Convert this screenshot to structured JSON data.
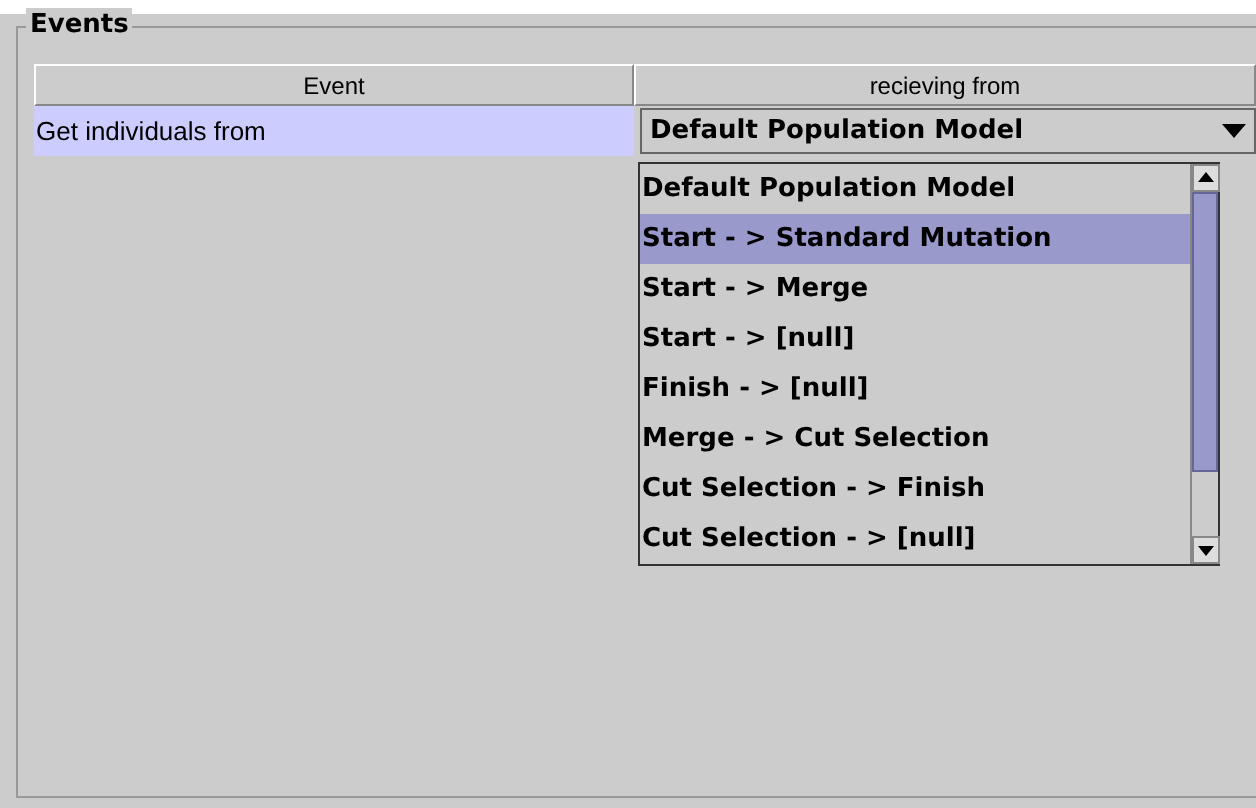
{
  "group": {
    "title": "Events"
  },
  "table": {
    "columns": [
      "Event",
      "recieving from"
    ],
    "rows": [
      {
        "event": "Get individuals from",
        "source": "Default Population Model",
        "selected": true
      }
    ]
  },
  "dropdown": {
    "expanded": true,
    "items": [
      {
        "label": "Default Population Model",
        "selected": false
      },
      {
        "label": "Start - > Standard Mutation",
        "selected": true
      },
      {
        "label": "Start - > Merge",
        "selected": false
      },
      {
        "label": "Start - > [null]",
        "selected": false
      },
      {
        "label": "Finish - > [null]",
        "selected": false
      },
      {
        "label": "Merge - > Cut Selection",
        "selected": false
      },
      {
        "label": "Cut Selection - > Finish",
        "selected": false
      },
      {
        "label": "Cut Selection - > [null]",
        "selected": false
      }
    ]
  }
}
